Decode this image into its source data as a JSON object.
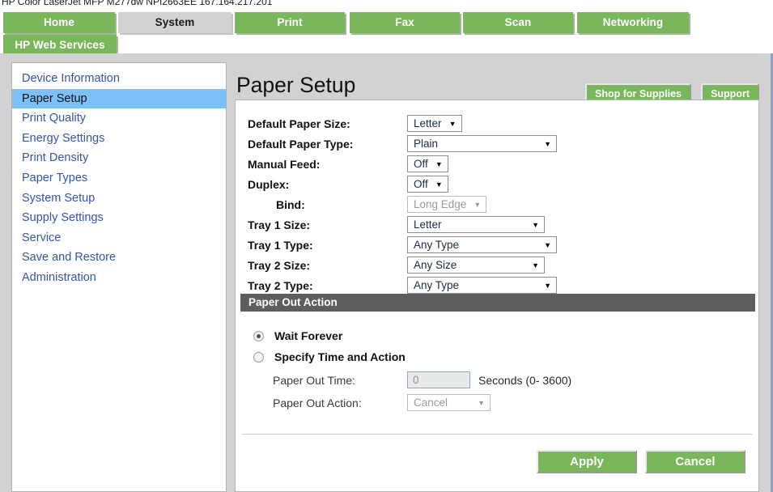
{
  "browser": {
    "title": "HP Color LaserJet MFP M277dw   NPI2663EE   167.164.217.201"
  },
  "colors": {
    "tab_green": "#7ab75c",
    "tab_active_gray": "#d2d2d2",
    "nav_link_blue": "#3554a6",
    "nav_selected_blue": "#7cc0fa",
    "section_bar_gray": "#5e5e5e",
    "page_background": "#d2d2d2"
  },
  "tabs": [
    {
      "label": "Home",
      "active": false
    },
    {
      "label": "System",
      "active": true
    },
    {
      "label": "Print",
      "active": false
    },
    {
      "label": "Fax",
      "active": false
    },
    {
      "label": "Scan",
      "active": false
    },
    {
      "label": "Networking",
      "active": false
    },
    {
      "label": "HP Web Services",
      "active": false
    }
  ],
  "sidebar": {
    "items": [
      {
        "label": "Device Information",
        "selected": false
      },
      {
        "label": "Paper Setup",
        "selected": true
      },
      {
        "label": "Print Quality",
        "selected": false
      },
      {
        "label": "Energy Settings",
        "selected": false
      },
      {
        "label": "Print Density",
        "selected": false
      },
      {
        "label": "Paper Types",
        "selected": false
      },
      {
        "label": "System Setup",
        "selected": false
      },
      {
        "label": "Supply Settings",
        "selected": false
      },
      {
        "label": "Service",
        "selected": false
      },
      {
        "label": "Save and Restore",
        "selected": false
      },
      {
        "label": "Administration",
        "selected": false
      }
    ]
  },
  "header": {
    "page_title": "Paper Setup",
    "shop_button": "Shop for Supplies",
    "support_button": "Support"
  },
  "form": {
    "rows": [
      {
        "label": "Default Paper Size:",
        "value": "Letter",
        "width": "auto",
        "disabled": false,
        "indent": false
      },
      {
        "label": "Default Paper Type:",
        "value": "Plain",
        "width": "w-185",
        "disabled": false,
        "indent": false
      },
      {
        "label": "Manual Feed:",
        "value": "Off",
        "width": "auto",
        "disabled": false,
        "indent": false
      },
      {
        "label": "Duplex:",
        "value": "Off",
        "width": "auto",
        "disabled": false,
        "indent": false
      },
      {
        "label": "Bind:",
        "value": "Long Edge",
        "width": "auto",
        "disabled": true,
        "indent": true
      },
      {
        "label": "Tray 1 Size:",
        "value": "Letter",
        "width": "w-170",
        "disabled": false,
        "indent": false
      },
      {
        "label": "Tray 1 Type:",
        "value": "Any Type",
        "width": "w-185",
        "disabled": false,
        "indent": false
      },
      {
        "label": "Tray 2 Size:",
        "value": "Any Size",
        "width": "w-170",
        "disabled": false,
        "indent": false
      },
      {
        "label": "Tray 2 Type:",
        "value": "Any Type",
        "width": "w-185",
        "disabled": false,
        "indent": false
      }
    ]
  },
  "paper_out": {
    "section_title": "Paper Out Action",
    "option_wait": "Wait Forever",
    "option_specify": "Specify Time and Action",
    "selected_option": "Wait Forever",
    "time_label": "Paper Out Time:",
    "time_value": "0",
    "time_units": "Seconds (0- 3600)",
    "action_label": "Paper Out Action:",
    "action_value": "Cancel"
  },
  "footer": {
    "apply_button": "Apply",
    "cancel_button": "Cancel"
  }
}
